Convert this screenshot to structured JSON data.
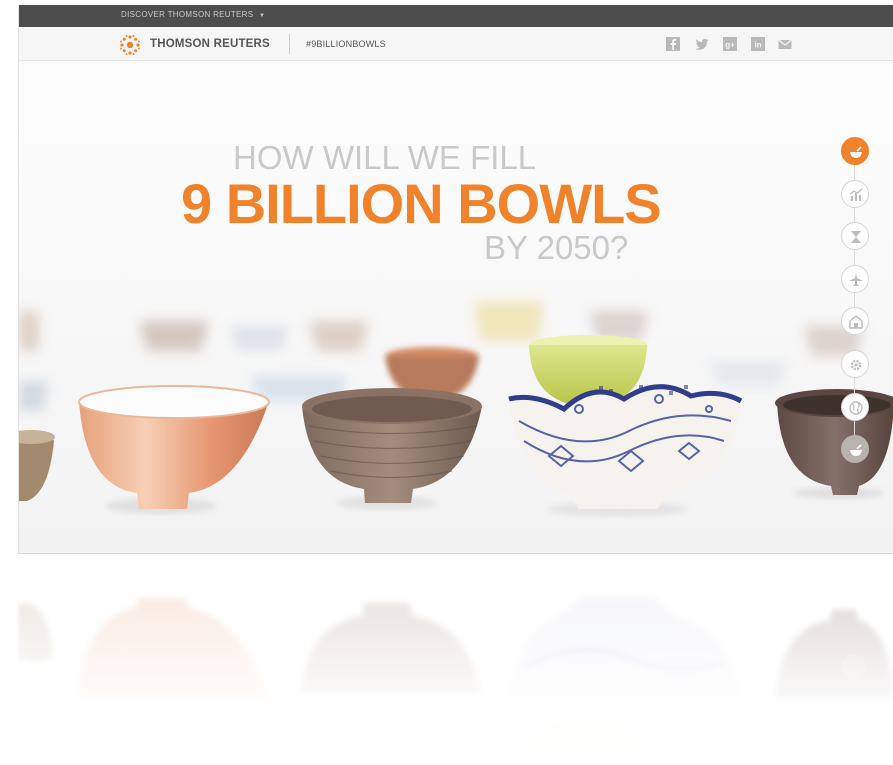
{
  "topbar": {
    "discover_label": "DISCOVER THOMSON REUTERS"
  },
  "nav": {
    "brand": "THOMSON REUTERS",
    "hashtag": "#9BILLIONBOWLS",
    "social_icons": [
      "facebook-icon",
      "twitter-icon",
      "google-plus-icon",
      "linkedin-icon",
      "mail-icon"
    ]
  },
  "hero": {
    "line1": "HOW WILL WE FILL",
    "line2": "9 BILLION BOWLS",
    "line3": "BY 2050?"
  },
  "side_nav": {
    "icons": [
      "bowl-icon",
      "chart-icon",
      "hourglass-icon",
      "plane-icon",
      "building-icon",
      "gear-icon",
      "globe-icon",
      "bowl-icon"
    ],
    "active_index": 0
  },
  "colors": {
    "accent": "#f0822c",
    "topbar": "#4d4d4d",
    "headline_gray": "#c9c9c9"
  }
}
